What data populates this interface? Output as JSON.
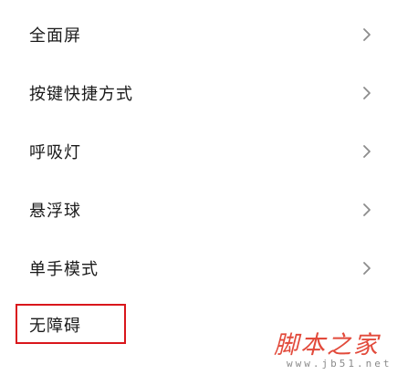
{
  "settings": {
    "items": [
      {
        "label": "全面屏",
        "has_chevron": true,
        "icon": "chevron-right-icon"
      },
      {
        "label": "按键快捷方式",
        "has_chevron": true,
        "icon": "chevron-right-icon"
      },
      {
        "label": "呼吸灯",
        "has_chevron": true,
        "icon": "chevron-right-icon"
      },
      {
        "label": "悬浮球",
        "has_chevron": true,
        "icon": "chevron-right-icon"
      },
      {
        "label": "单手模式",
        "has_chevron": true,
        "icon": "chevron-right-icon"
      },
      {
        "label": "无障碍",
        "has_chevron": false,
        "highlighted": true
      }
    ]
  },
  "annotation": {
    "highlight_color": "#d9161b"
  },
  "watermark": {
    "cn_text": "脚本之家",
    "url": "www.jb51.net",
    "color": "#e24a3b"
  }
}
